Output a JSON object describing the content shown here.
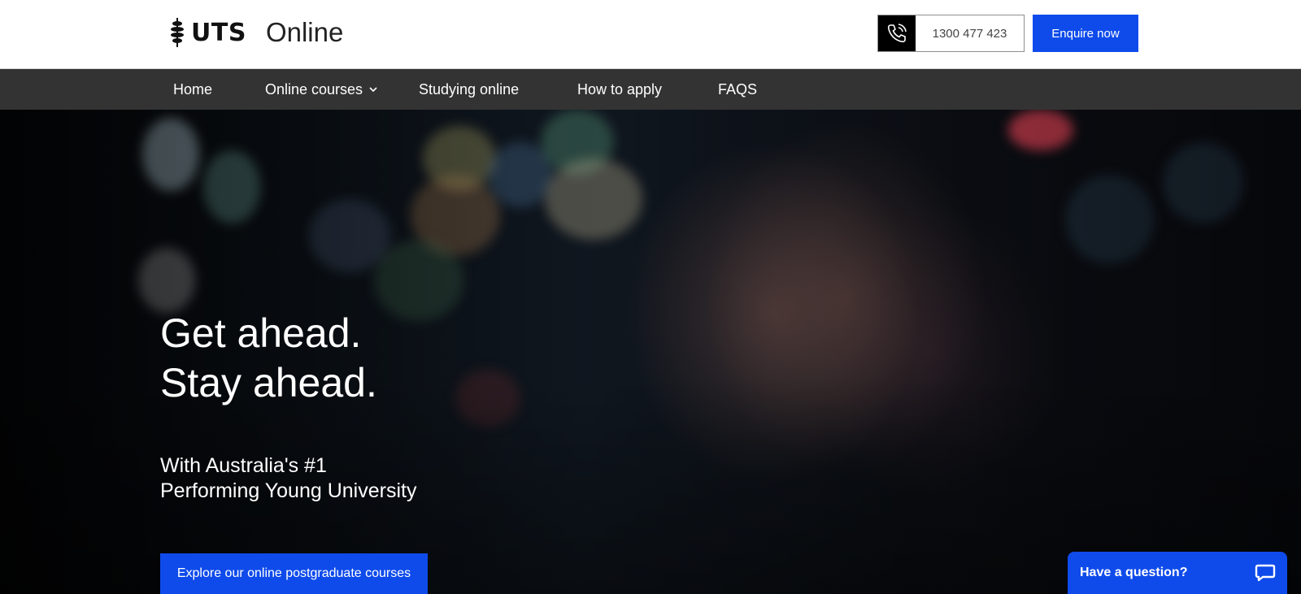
{
  "header": {
    "logo_text": "UTS",
    "logo_sub": "Online",
    "phone_number": "1300 477 423",
    "enquire_label": "Enquire now"
  },
  "nav": {
    "items": [
      {
        "label": "Home"
      },
      {
        "label": "Online courses"
      },
      {
        "label": "Studying online"
      },
      {
        "label": "How to apply"
      },
      {
        "label": "FAQS"
      }
    ]
  },
  "hero": {
    "headline_1": "Get ahead.",
    "headline_2": "Stay ahead.",
    "sub_1": "With Australia's #1",
    "sub_2": "Performing Young University",
    "cta_label": "Explore our online postgraduate courses"
  },
  "chat": {
    "label": "Have a question?"
  },
  "colors": {
    "accent": "#0f4beb",
    "nav_bg": "#333333",
    "header_bg": "#ffffff"
  },
  "icons": [
    "uts-crest-icon",
    "phone-icon",
    "chevron-down-icon",
    "chat-bubble-icon"
  ]
}
